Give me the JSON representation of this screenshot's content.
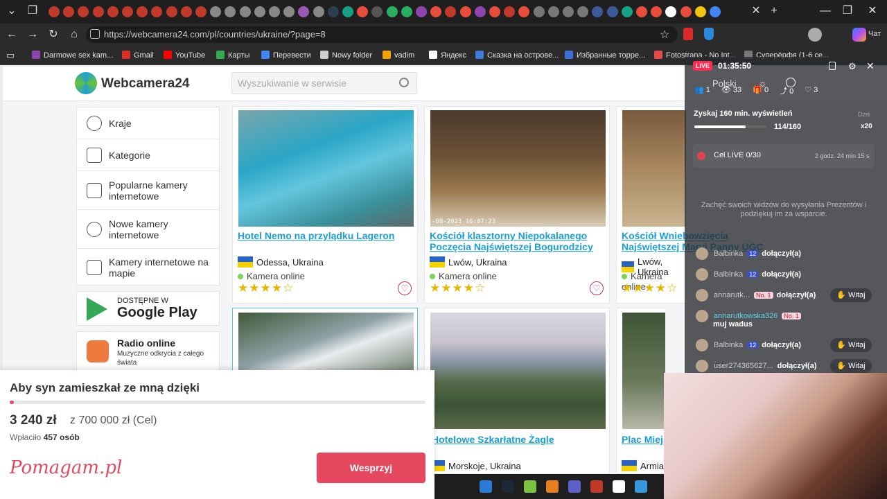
{
  "browser": {
    "url": "https://webcamera24.com/pl/countries/ukraine/?page=8",
    "bookmarks": [
      {
        "label": "Darmowe sex kam...",
        "color": "#8e44ad"
      },
      {
        "label": "Gmail",
        "color": "#d93025"
      },
      {
        "label": "YouTube",
        "color": "#ff0000"
      },
      {
        "label": "Карты",
        "color": "#34a853"
      },
      {
        "label": "Перевести",
        "color": "#4285f4"
      },
      {
        "label": "Nowy folder",
        "color": "#cccccc"
      },
      {
        "label": "vadim",
        "color": "#f4a300"
      },
      {
        "label": "Яндекс",
        "color": "#ffffff"
      },
      {
        "label": "Сказка на острове...",
        "color": "#3d7bd9"
      },
      {
        "label": "Избранные торре...",
        "color": "#3f6fd6"
      },
      {
        "label": "Fotostrana - No Int...",
        "color": "#e34b4b"
      },
      {
        "label": "Суперёрфя (1-6 се...",
        "color": "#777777"
      }
    ],
    "copilot_label": "Чат"
  },
  "site": {
    "name": "Webcamera24",
    "search_placeholder": "Wyszukiwanie w serwisie",
    "sidebar": [
      {
        "label": "Kraje",
        "icon": "globe-icon"
      },
      {
        "label": "Kategorie",
        "icon": "palm-icon"
      },
      {
        "label": "Popularne kamery internetowe",
        "icon": "thumbs-up-icon"
      },
      {
        "label": "Nowe kamery internetowe",
        "icon": "new-badge-icon"
      },
      {
        "label": "Kamery internetowe na mapie",
        "icon": "map-icon"
      }
    ],
    "google_play": {
      "small": "DOSTĘPNE W",
      "big": "Google Play"
    },
    "radio": {
      "title": "Radio online",
      "subtitle": "Muzyczne odkrycia z całego świata"
    },
    "cams": [
      {
        "title": "Hotel Nemo na przylądku Lageron",
        "location": "Odessa, Ukraina",
        "status": "Kamera online",
        "stars": "★★★★☆",
        "stamp": ""
      },
      {
        "title": "Kościół klasztorny Niepokalanego Poczęcia Najświętszej Bogurodzicy",
        "location": "Lwów, Ukraina",
        "status": "Kamera online",
        "stars": "★★★★☆",
        "stamp": "-08-2023 16:07:23"
      },
      {
        "title": "Kościół Wniebowzięcia Najświętszej Maryi Panny UGC",
        "location": "Lwów, Ukraina",
        "status": "Kamera online",
        "stars": "★★★★☆",
        "stamp": ""
      },
      {
        "title": "",
        "location": "",
        "status": "",
        "stars": "",
        "stamp": ""
      },
      {
        "title": "Hotelowe Szkarłatne Żagle",
        "location": "Morskoje, Ukraina",
        "status": "",
        "stars": "",
        "stamp": ""
      },
      {
        "title": "Plac Miejs",
        "location": "Armia",
        "status": "",
        "stars": "",
        "stamp": ""
      }
    ]
  },
  "stream": {
    "live_badge": "LIVE",
    "timer": "01:35:50",
    "language": "Polski",
    "stats": {
      "users": "1",
      "viewers": "33",
      "gifts": "0",
      "shares": "0",
      "likes": "3"
    },
    "goal": {
      "title": "Zyskaj 160 min. wyświetleń",
      "when": "Dziś",
      "progress_text": "114/160",
      "progress_fraction": 0.7125,
      "reward": "x20"
    },
    "live_goal": {
      "label": "Cel LIVE 0/30",
      "time_left": "2 godz. 24 min 15 s"
    },
    "encourage": "Zachęć swoich widzów do wysyłania Prezentów i podziękuj im za wsparcie.",
    "chat": [
      {
        "user": "Balbinka",
        "level": "12",
        "badge": "",
        "text": "dołączył(a)",
        "witaj": false
      },
      {
        "user": "Balbinka",
        "level": "12",
        "badge": "",
        "text": "dołączył(a)",
        "witaj": false
      },
      {
        "user": "annarutk...",
        "level": "",
        "badge": "No. 1",
        "text": "dołączył(a)",
        "witaj": true
      },
      {
        "user": "annarutkowska326",
        "level": "",
        "badge": "No. 1",
        "text": "muj wadus",
        "witaj": false
      },
      {
        "user": "Balbinka",
        "level": "12",
        "badge": "",
        "text": "dołączył(a)",
        "witaj": true
      },
      {
        "user": "user274365627...",
        "level": "",
        "badge": "",
        "text": "dołączył(a)",
        "witaj": true
      }
    ],
    "witaj_label": "Witaj"
  },
  "donation": {
    "title": "Aby syn zamieszkał ze mną dzięki",
    "amount": "3 240 zł",
    "goal": "z 700 000 zł (Cel)",
    "paid_prefix": "Wpłaciło",
    "paid_count": "457 osób",
    "progress_fraction": 0.0046,
    "brand": "Pomagam.pl",
    "button": "Wesprzyj",
    "brand_color": "#e5485f"
  }
}
